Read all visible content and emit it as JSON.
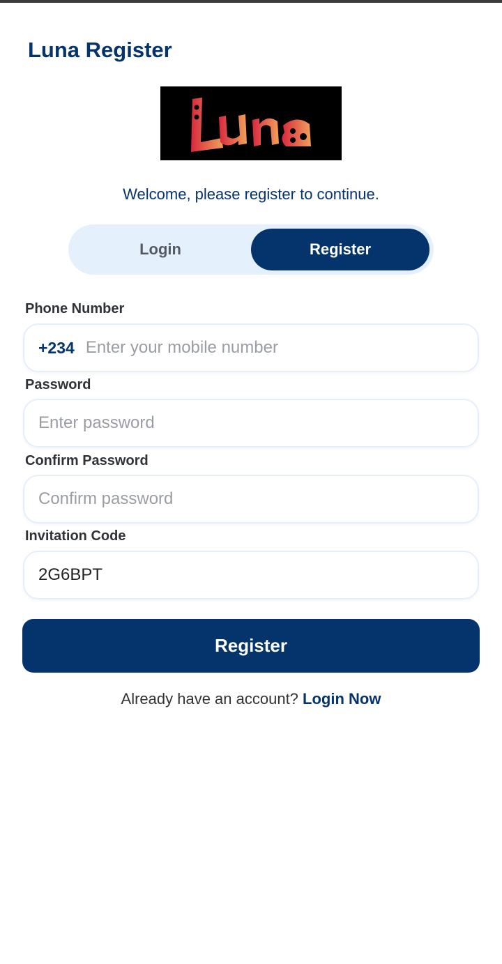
{
  "header": {
    "title": "Luna Register"
  },
  "logo": {
    "text": "Luna",
    "icon": "luna-logo-icon",
    "colors": {
      "background": "#000000",
      "gradient_start": "#d8283e",
      "gradient_end": "#f0a05a"
    }
  },
  "welcome_text": "Welcome, please register to continue.",
  "tabs": {
    "login_label": "Login",
    "register_label": "Register",
    "active": "Register"
  },
  "form": {
    "phone": {
      "label": "Phone Number",
      "prefix": "+234",
      "placeholder": "Enter your mobile number",
      "value": ""
    },
    "password": {
      "label": "Password",
      "placeholder": "Enter password",
      "value": ""
    },
    "confirm_password": {
      "label": "Confirm Password",
      "placeholder": "Confirm password",
      "value": ""
    },
    "invitation_code": {
      "label": "Invitation Code",
      "placeholder": "",
      "value": "2G6BPT"
    },
    "submit_label": "Register"
  },
  "footer": {
    "prompt": "Already have an account?",
    "link_label": "Login Now"
  },
  "colors": {
    "primary": "#05336b",
    "segment_background": "#e5f0fd",
    "field_border": "#e6eef9"
  }
}
